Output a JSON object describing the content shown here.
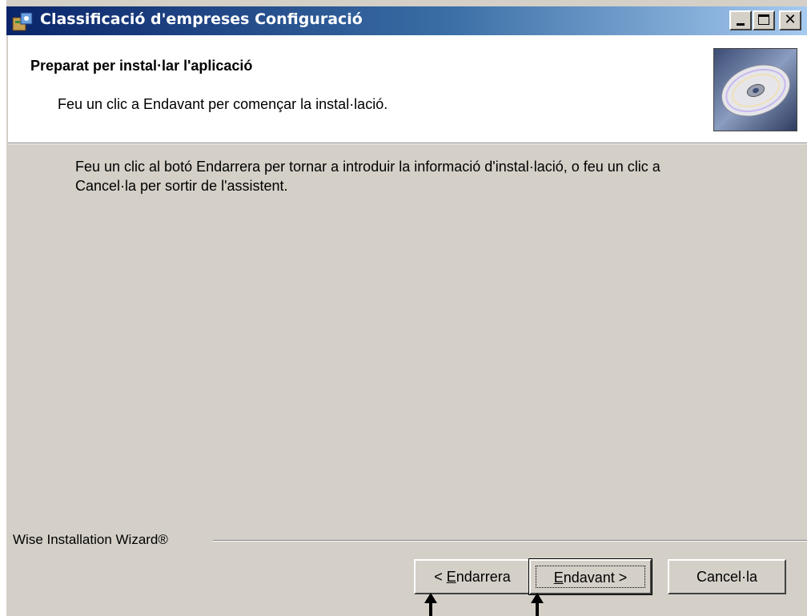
{
  "window": {
    "title": "Classificació d'empreses Configuració",
    "minimize_icon": "minimize-icon",
    "maximize_icon": "maximize-icon",
    "close_icon": "close-icon",
    "close_glyph": "✕"
  },
  "header": {
    "title": "Preparat per instal·lar l'aplicació",
    "subtitle": "Feu un clic a Endavant per començar la instal·lació.",
    "image_icon": "cd-disc-icon"
  },
  "body": {
    "text": "Feu un clic al botó Endarrera per tornar a introduir la informació d'instal·lació, o feu un clic a Cancel·la per sortir de l'assistent."
  },
  "footer": {
    "brand": "Wise Installation Wizard®"
  },
  "buttons": {
    "back": {
      "prefix": "< ",
      "accel": "E",
      "rest": "ndarrera"
    },
    "next": {
      "accel": "E",
      "rest": "ndavant >"
    },
    "cancel": {
      "label": "Cancel·la"
    }
  },
  "annotations": {
    "arrow_icon": "up-arrow-icon"
  },
  "colors": {
    "titlebar_start": "#0a246a",
    "titlebar_end": "#a6caf0",
    "dialog_bg": "#d4d0c8",
    "header_bg": "#ffffff"
  }
}
